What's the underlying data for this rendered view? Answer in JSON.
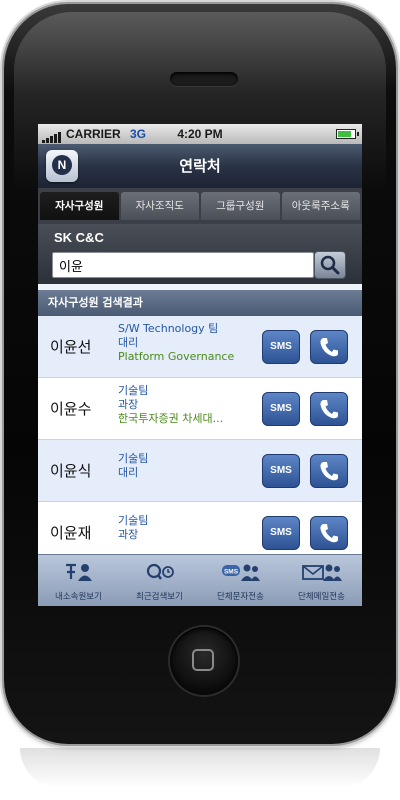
{
  "status": {
    "carrier": "CARRIER",
    "network": "3G",
    "time": "4:20 PM",
    "battery_level": 0.8
  },
  "navbar": {
    "title": "연락처",
    "logo_letter": "N"
  },
  "tabs": [
    {
      "label": "자사구성원",
      "active": true
    },
    {
      "label": "자사조직도",
      "active": false
    },
    {
      "label": "그룹구성원",
      "active": false
    },
    {
      "label": "아웃룩주소록",
      "active": false
    }
  ],
  "search": {
    "company": "SK C&C",
    "value": "이윤"
  },
  "results": {
    "header": "자사구성원 검색결과",
    "sms_label": "SMS",
    "rows": [
      {
        "name": "이윤선",
        "dept": "S/W Technology 팀",
        "title": "대리",
        "extra": "Platform Governance"
      },
      {
        "name": "이윤수",
        "dept": "기술팀",
        "title": "과장",
        "extra": "한국투자증권 차세대..."
      },
      {
        "name": "이윤식",
        "dept": "기술팀",
        "title": "대리",
        "extra": ""
      },
      {
        "name": "이윤재",
        "dept": "기술팀",
        "title": "과장",
        "extra": ""
      }
    ]
  },
  "tabbar": [
    {
      "label": "내소속원보기",
      "icon": "org-people-icon"
    },
    {
      "label": "최근검색보기",
      "icon": "search-clock-icon"
    },
    {
      "label": "단체문자전송",
      "icon": "sms-group-icon"
    },
    {
      "label": "단체메일전송",
      "icon": "mail-group-icon"
    }
  ],
  "colors": {
    "accent": "#2e5394",
    "link": "#2556a6",
    "extra": "#4b8a1a",
    "navbar": "#2a3346"
  }
}
